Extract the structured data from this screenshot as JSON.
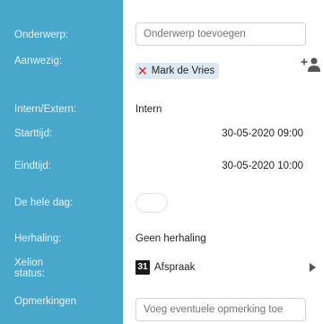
{
  "fields": {
    "subject": {
      "label": "Onderwerp:",
      "placeholder": "Onderwerp toevoegen"
    },
    "present": {
      "label": "Aanwezig:",
      "attendee": "Mark de Vries",
      "remove_symbol": "✕"
    },
    "internal_external": {
      "label": "Intern/Extern:",
      "value": "Intern"
    },
    "start": {
      "label": "Starttijd:",
      "value": "30-05-2020 09:00"
    },
    "end": {
      "label": "Eindtijd:",
      "value": "30-05-2020 10:00"
    },
    "all_day": {
      "label": "De hele dag:",
      "enabled": false
    },
    "repeat": {
      "label": "Herhaling:",
      "value": "Geen herhaling"
    },
    "status": {
      "label_line1": "Xelion",
      "label_line2": "status:",
      "calendar_day": "31",
      "value": "Afspraak"
    },
    "remarks": {
      "label": "Opmerkingen",
      "placeholder": "Voeg eventuele opmerking toe"
    }
  },
  "colors": {
    "label_column": "#4aa7cc",
    "chip_background": "#dde9f2",
    "remove_x": "#dd2222"
  },
  "icons": {
    "add_person": "add-person-icon",
    "calendar": "calendar-icon",
    "chevron": "chevron-right-icon"
  }
}
